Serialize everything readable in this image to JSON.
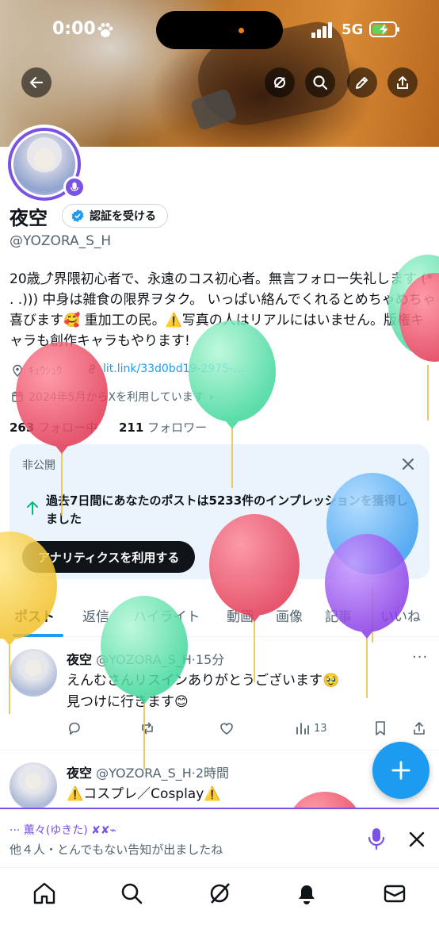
{
  "status": {
    "time": "0:00",
    "network": "5G"
  },
  "profile": {
    "name": "夜空",
    "verify_label": "認証を受ける",
    "handle": "@YOZORA_S_H",
    "bio": "20歳⤴︎界隈初心者で、永遠のコス初心者。無言フォロー失礼します (* . .))) 中身は雑食の限界ヲタク。 いっぱい絡んでくれるとめちゃめちゃ喜びます🥰 重加工の民。⚠️写真の人はリアルにはいません。版権キャラも創作キャラもやります!",
    "location": "ｷｭｳｼｭｳ",
    "link": "lit.link/33d0bd19-2975-...",
    "joined": "2024年5月からXを利用しています",
    "following_count": "263",
    "following_label": "フォロー中",
    "followers_count": "211",
    "followers_label": "フォロワー"
  },
  "card": {
    "label": "非公開",
    "message": "過去7日間にあなたのポストは5233件のインプレッションを獲得しました",
    "button": "アナリティクスを利用する"
  },
  "tabs": [
    "ポスト",
    "返信",
    "ハイライト",
    "動画",
    "画像",
    "記事",
    "いいね"
  ],
  "posts": [
    {
      "name": "夜空",
      "handle": "@YOZORA_S_H",
      "time": "·15分",
      "line1": "えんむさんリスインありがとうございます🥹",
      "line2": "見つけに行きます😊",
      "views": "13"
    },
    {
      "name": "夜空",
      "handle": "@YOZORA_S_H",
      "time": "·2時間",
      "line1": "⚠️コスプレ／Cosplay⚠️"
    }
  ],
  "live": {
    "host": "··· 薫々(ゆきた) ✘✘⌁",
    "text": "他４人・とんでもない告知が出ましたね"
  },
  "colors": {
    "accent": "#1d9bf0",
    "spaces_purple": "#7a53e6"
  },
  "icons": [
    "back-icon",
    "grok-icon",
    "search-icon",
    "edit-icon",
    "share-icon",
    "verified-icon",
    "mic-icon",
    "location-icon",
    "link-icon",
    "calendar-icon",
    "close-icon",
    "arrow-up-icon",
    "reply-icon",
    "repost-icon",
    "like-icon",
    "views-icon",
    "bookmark-icon",
    "compose-icon",
    "home-icon",
    "notifications-icon",
    "messages-icon"
  ]
}
